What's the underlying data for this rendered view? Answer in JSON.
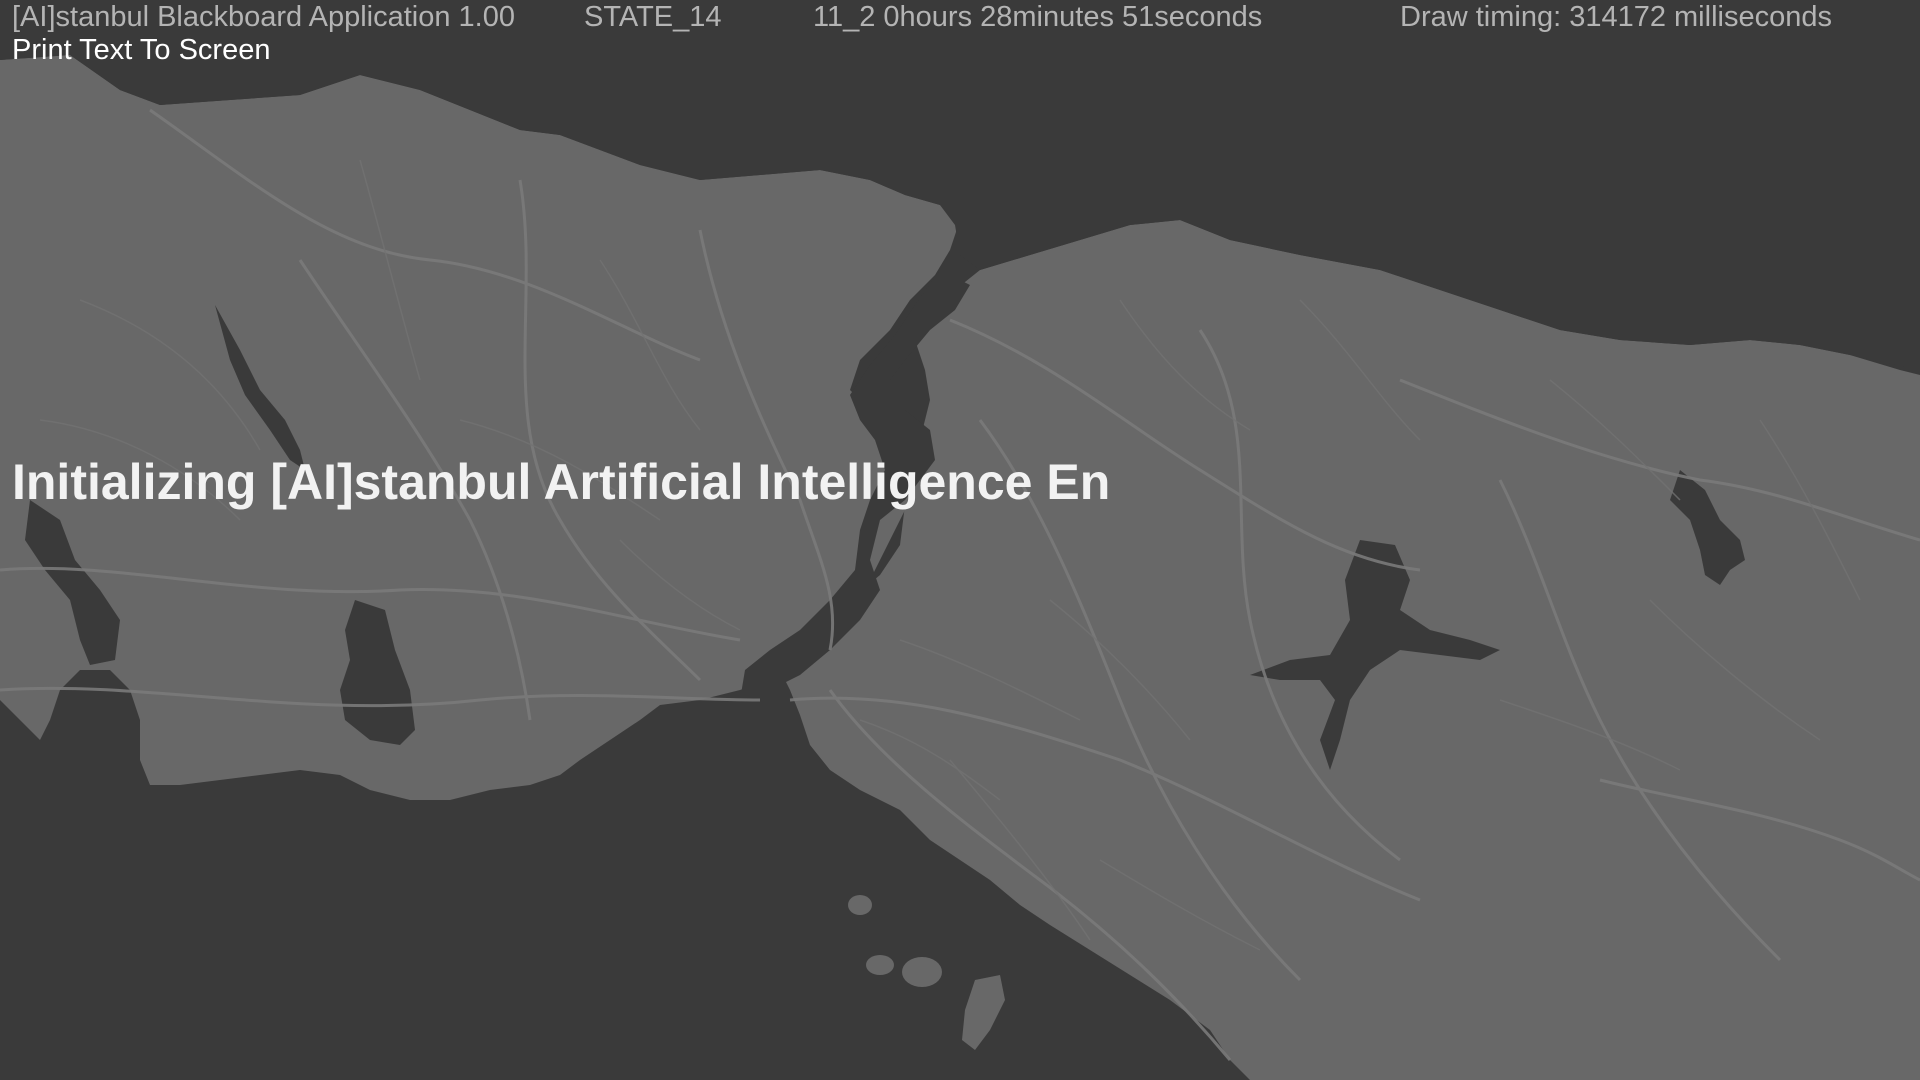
{
  "hud": {
    "app_title": "[AI]stanbul Blackboard Application 1.00",
    "state": "STATE_14",
    "elapsed": "11_2  0hours 28minutes 51seconds",
    "draw_timing": "Draw timing: 314172 milliseconds",
    "subtitle": "Print Text To Screen"
  },
  "overlay": {
    "message": "Initializing [AI]stanbul Artificial Intelligence En"
  },
  "colors": {
    "background": "#3a3a3a",
    "land": "#686868",
    "roads": "#7a7a7a",
    "water": "#3a3a3a",
    "hud_text": "#b4b4b4",
    "highlight_text": "#ffffff"
  },
  "icons": {
    "map": "istanbul-region-map"
  }
}
